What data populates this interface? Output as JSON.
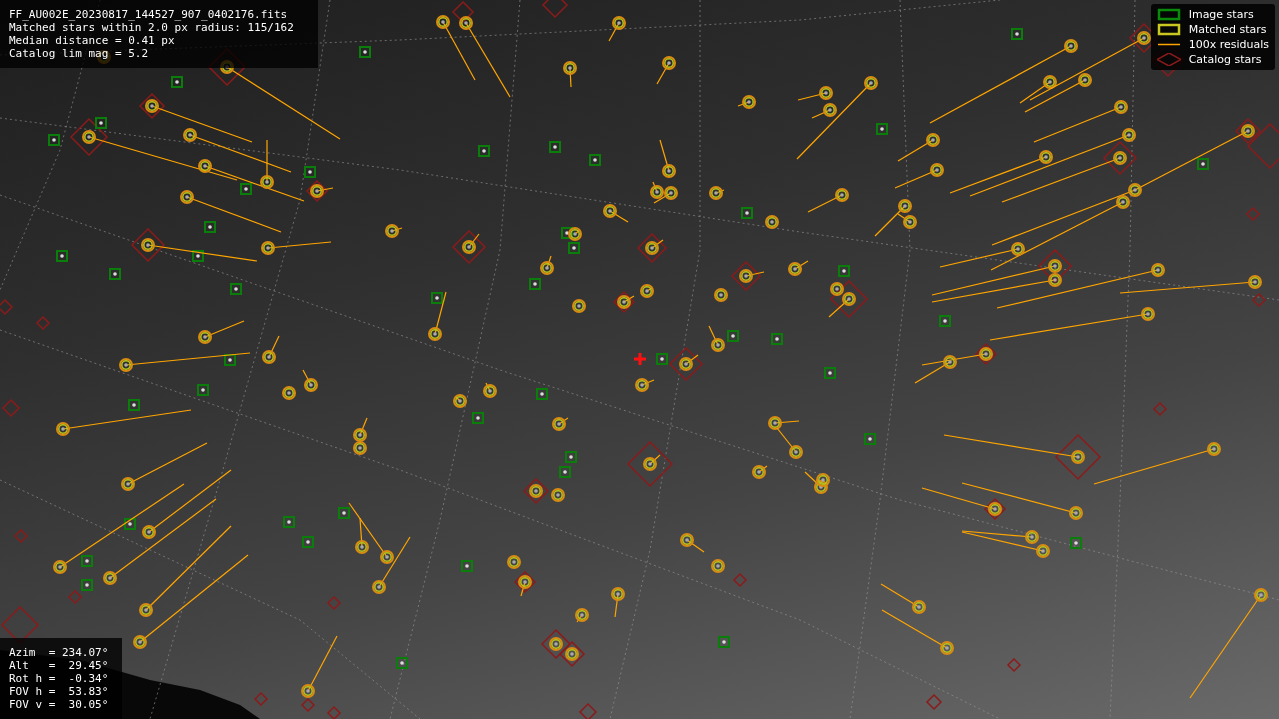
{
  "info_panel": {
    "lines": [
      "FF_AU002E_20230817_144527_907_0402176.fits",
      "Matched stars within 2.0 px radius: 115/162",
      "Median distance = 0.41 px",
      "Catalog lim mag = 5.2"
    ]
  },
  "legend": {
    "items": [
      {
        "kind": "image",
        "label": "Image stars"
      },
      {
        "kind": "matched",
        "label": "Matched stars"
      },
      {
        "kind": "residual",
        "label": "100x residuals"
      },
      {
        "kind": "catalog",
        "label": "Catalog stars"
      }
    ]
  },
  "pointing_panel": {
    "lines": [
      "Azim  = 234.07°",
      "Alt   =  29.45°",
      "Rot h =  -0.34°",
      "FOV h =  53.83°",
      "FOV v =  30.05°"
    ]
  }
}
